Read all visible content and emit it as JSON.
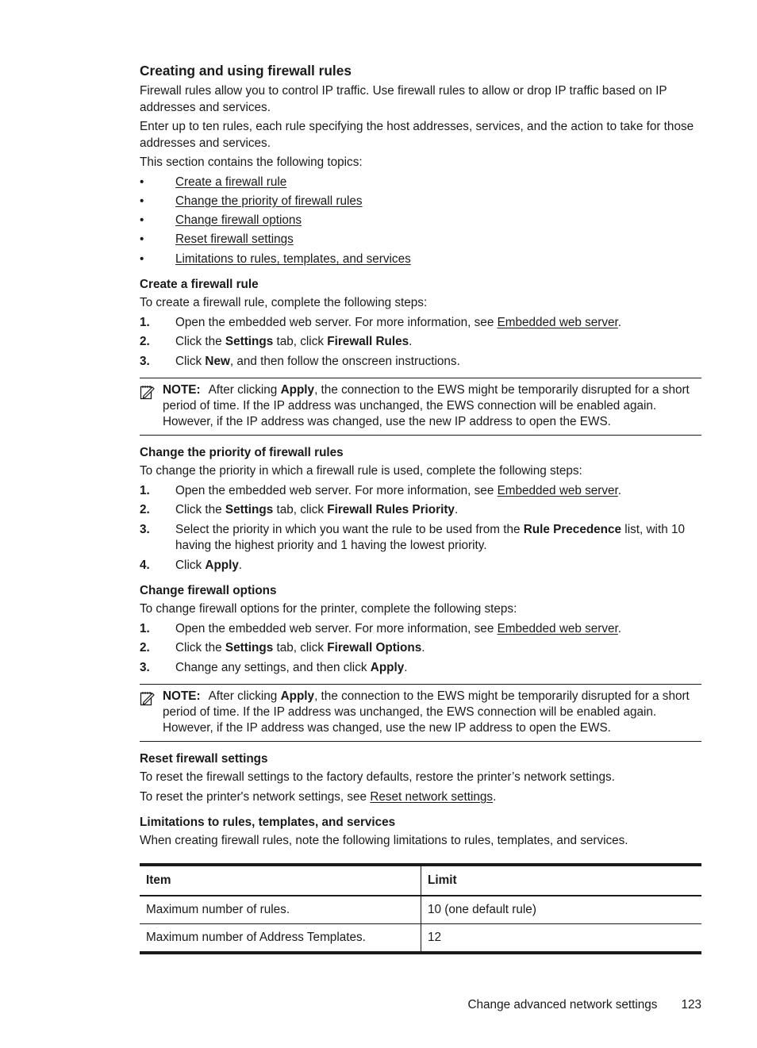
{
  "title": "Creating and using firewall rules",
  "intro": [
    "Firewall rules allow you to control IP traffic. Use firewall rules to allow or drop IP traffic based on IP addresses and services.",
    "Enter up to ten rules, each rule specifying the host addresses, services, and the action to take for those addresses and services.",
    "This section contains the following topics:"
  ],
  "bullet": "•",
  "topics": [
    "Create a firewall rule",
    "Change the priority of firewall rules",
    "Change firewall options",
    "Reset firewall settings",
    "Limitations to rules, templates, and services"
  ],
  "icons": {
    "note": "note-pencil-icon"
  },
  "ews_link": "Embedded web server",
  "create": {
    "heading": "Create a firewall rule",
    "lead": "To create a firewall rule, complete the following steps:",
    "steps": [
      {
        "num": "1.",
        "pre": "Open the embedded web server. For more information, see ",
        "link": "Embedded web server",
        "post": "."
      },
      {
        "num": "2.",
        "pre": "Click the ",
        "b1": "Settings",
        "mid": " tab, click ",
        "b2": "Firewall Rules",
        "post": "."
      },
      {
        "num": "3.",
        "pre": "Click ",
        "b1": "New",
        "post": ", and then follow the onscreen instructions."
      }
    ]
  },
  "note": {
    "label": "NOTE:",
    "pre": "After clicking ",
    "bold": "Apply",
    "post": ", the connection to the EWS might be temporarily disrupted for a short period of time. If the IP address was unchanged, the EWS connection will be enabled again. However, if the IP address was changed, use the new IP address to open the EWS."
  },
  "priority": {
    "heading": "Change the priority of firewall rules",
    "lead": "To change the priority in which a firewall rule is used, complete the following steps:",
    "steps": [
      {
        "num": "1.",
        "pre": "Open the embedded web server. For more information, see ",
        "link": "Embedded web server",
        "post": "."
      },
      {
        "num": "2.",
        "pre": "Click the ",
        "b1": "Settings",
        "mid": " tab, click ",
        "b2": "Firewall Rules Priority",
        "post": "."
      },
      {
        "num": "3.",
        "pre": "Select the priority in which you want the rule to be used from the ",
        "b1": "Rule Precedence",
        "post": " list, with 10 having the highest priority and 1 having the lowest priority."
      },
      {
        "num": "4.",
        "pre": "Click ",
        "b1": "Apply",
        "post": "."
      }
    ]
  },
  "options": {
    "heading": "Change firewall options",
    "lead": "To change firewall options for the printer, complete the following steps:",
    "steps": [
      {
        "num": "1.",
        "pre": "Open the embedded web server. For more information, see ",
        "link": "Embedded web server",
        "post": "."
      },
      {
        "num": "2.",
        "pre": "Click the ",
        "b1": "Settings",
        "mid": " tab, click ",
        "b2": "Firewall Options",
        "post": "."
      },
      {
        "num": "3.",
        "pre": "Change any settings, and then click ",
        "b1": "Apply",
        "post": "."
      }
    ]
  },
  "reset": {
    "heading": "Reset firewall settings",
    "p1": "To reset the firewall settings to the factory defaults, restore the printer’s network settings.",
    "p2_pre": "To reset the printer's network settings, see ",
    "p2_link": "Reset network settings",
    "p2_post": "."
  },
  "limits": {
    "heading": "Limitations to rules, templates, and services",
    "lead": "When creating firewall rules, note the following limitations to rules, templates, and services.",
    "columns": [
      "Item",
      "Limit"
    ],
    "rows": [
      [
        "Maximum number of rules.",
        "10 (one default rule)"
      ],
      [
        "Maximum number of Address Templates.",
        "12"
      ]
    ]
  },
  "footer": {
    "section": "Change advanced network settings",
    "page": "123"
  }
}
